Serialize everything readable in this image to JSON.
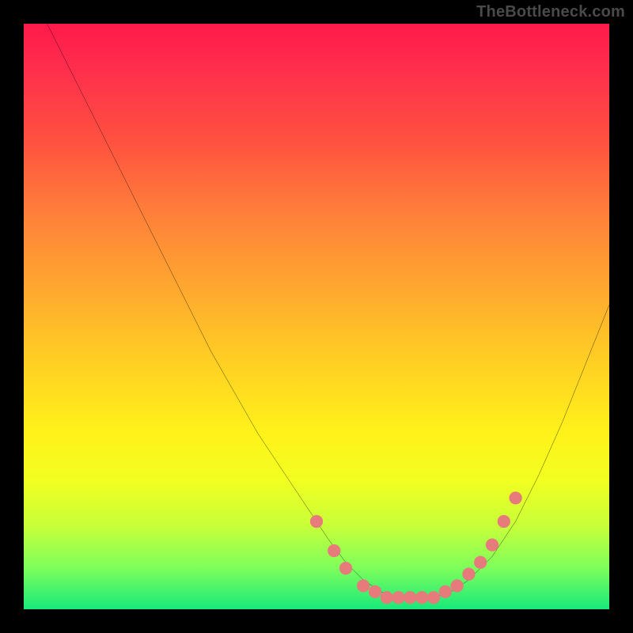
{
  "watermark": "TheBottleneck.com",
  "chart_data": {
    "type": "line",
    "title": "",
    "xlabel": "",
    "ylabel": "",
    "xlim": [
      0,
      100
    ],
    "ylim": [
      0,
      100
    ],
    "series": [
      {
        "name": "curve",
        "x": [
          4,
          8,
          12,
          16,
          20,
          24,
          28,
          32,
          36,
          40,
          44,
          48,
          52,
          55,
          58,
          61,
          64,
          67,
          70,
          73,
          76,
          80,
          84,
          88,
          92,
          96,
          100
        ],
        "y": [
          100,
          92,
          84,
          76,
          68,
          60,
          52,
          44,
          37,
          30,
          24,
          18,
          12,
          8,
          5,
          3,
          2,
          2,
          2,
          3,
          5,
          9,
          15,
          23,
          32,
          42,
          52
        ]
      }
    ],
    "markers": {
      "name": "flat-region-dots",
      "color": "#e77b7b",
      "points": [
        {
          "x": 50,
          "y": 15
        },
        {
          "x": 53,
          "y": 10
        },
        {
          "x": 55,
          "y": 7
        },
        {
          "x": 58,
          "y": 4
        },
        {
          "x": 60,
          "y": 3
        },
        {
          "x": 62,
          "y": 2
        },
        {
          "x": 64,
          "y": 2
        },
        {
          "x": 66,
          "y": 2
        },
        {
          "x": 68,
          "y": 2
        },
        {
          "x": 70,
          "y": 2
        },
        {
          "x": 72,
          "y": 3
        },
        {
          "x": 74,
          "y": 4
        },
        {
          "x": 76,
          "y": 6
        },
        {
          "x": 78,
          "y": 8
        },
        {
          "x": 80,
          "y": 11
        },
        {
          "x": 82,
          "y": 15
        },
        {
          "x": 84,
          "y": 19
        }
      ]
    },
    "gradient_stops": [
      {
        "pos": 0.0,
        "color": "#ff1a4b"
      },
      {
        "pos": 0.5,
        "color": "#ffb82a"
      },
      {
        "pos": 0.75,
        "color": "#fff21a"
      },
      {
        "pos": 1.0,
        "color": "#17e87a"
      }
    ]
  }
}
